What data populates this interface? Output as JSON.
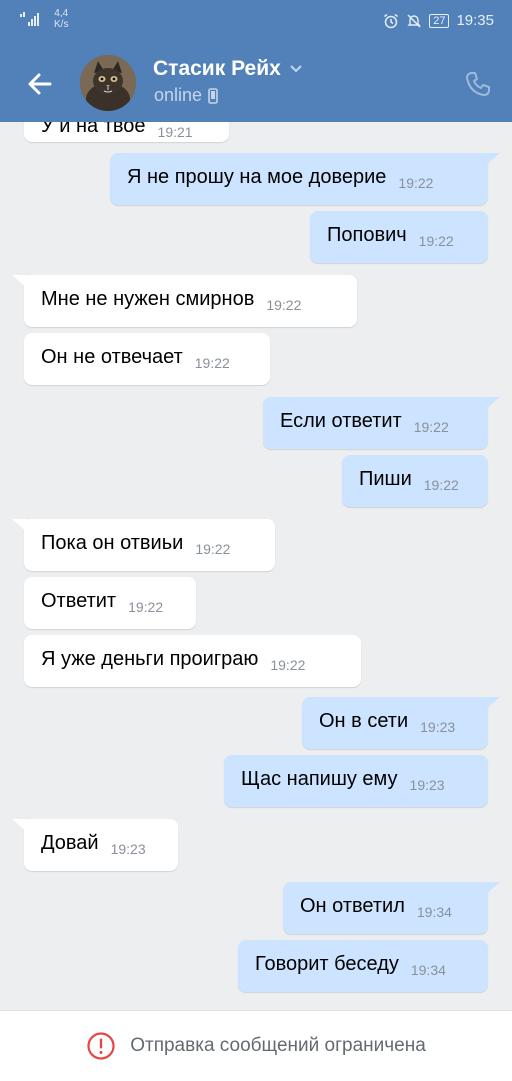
{
  "status_bar": {
    "speed_value": "4,4",
    "speed_unit": "K/s",
    "battery": "27",
    "time": "19:35"
  },
  "header": {
    "name": "Стасик Рейх",
    "status": "online"
  },
  "messages": [
    {
      "dir": "in",
      "text": "У и на твое",
      "time": "19:21"
    },
    {
      "dir": "out",
      "text": "Я не прошу на мое доверие",
      "time": "19:22"
    },
    {
      "dir": "out",
      "text": "Попович",
      "time": "19:22"
    },
    {
      "dir": "in",
      "text": "Мне не нужен смирнов",
      "time": "19:22"
    },
    {
      "dir": "in",
      "text": "Он не отвечает",
      "time": "19:22"
    },
    {
      "dir": "out",
      "text": "Если ответит",
      "time": "19:22"
    },
    {
      "dir": "out",
      "text": "Пиши",
      "time": "19:22"
    },
    {
      "dir": "in",
      "text": "Пока он отвиьи",
      "time": "19:22"
    },
    {
      "dir": "in",
      "text": "Ответит",
      "time": "19:22"
    },
    {
      "dir": "in",
      "text": "Я уже деньги проиграю",
      "time": "19:22"
    },
    {
      "dir": "out",
      "text": "Он в сети",
      "time": "19:23"
    },
    {
      "dir": "out",
      "text": "Щас напишу ему",
      "time": "19:23"
    },
    {
      "dir": "in",
      "text": "Довай",
      "time": "19:23"
    },
    {
      "dir": "out",
      "text": "Он ответил",
      "time": "19:34"
    },
    {
      "dir": "out",
      "text": "Говорит беседу",
      "time": "19:34"
    }
  ],
  "footer": {
    "text": "Отправка сообщений ограничена"
  },
  "colors": {
    "header": "#5181b8",
    "outgoing": "#cce4ff",
    "incoming": "#ffffff",
    "background": "#edeef0",
    "warning": "#e64646"
  },
  "icons": [
    "signal-icon",
    "alarm-icon",
    "mute-icon",
    "battery-icon",
    "back-arrow-icon",
    "chevron-down-icon",
    "mobile-icon",
    "phone-icon",
    "warning-icon"
  ]
}
